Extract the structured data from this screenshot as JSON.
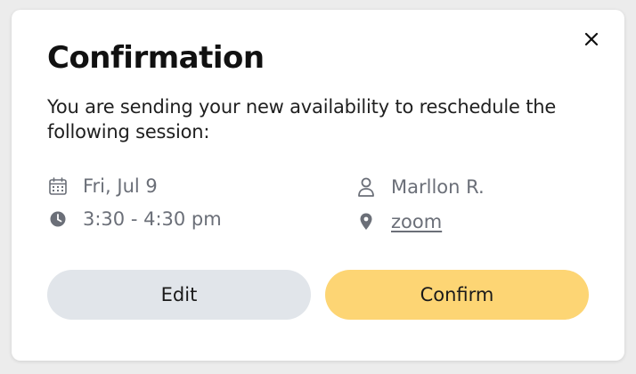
{
  "dialog": {
    "title": "Confirmation",
    "message": "You are sending your new availability to reschedule the following session:",
    "close_icon": "close-icon"
  },
  "session": {
    "date": "Fri, Jul 9",
    "date_icon": "calendar-icon",
    "time": "3:30 - 4:30 pm",
    "time_icon": "clock-icon",
    "person": "Marllon R.",
    "person_icon": "person-icon",
    "location": "zoom",
    "location_icon": "location-pin-icon"
  },
  "actions": {
    "edit_label": "Edit",
    "confirm_label": "Confirm"
  },
  "colors": {
    "edit_button_bg": "#e1e5ea",
    "confirm_button_bg": "#fdd574",
    "muted_text": "#6b6f78"
  }
}
